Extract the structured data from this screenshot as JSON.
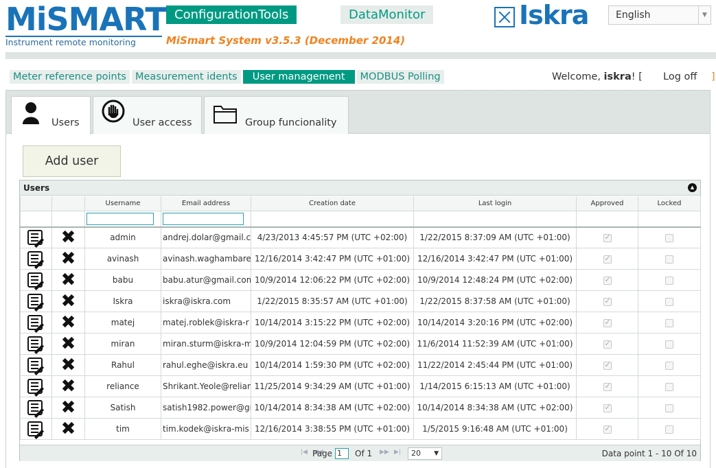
{
  "header": {
    "logo_text": "MiSMART",
    "logo_subtitle": "Instrument remote monitoring",
    "system_version": "MiSmart System v3.5.3 (December 2014)",
    "top_tabs": [
      "ConfigurationTools",
      "DataMonitor"
    ],
    "brand": "Iskra",
    "language": "English"
  },
  "nav": {
    "items": [
      "Meter reference points",
      "Measurement idents",
      "User management",
      "MODBUS Polling"
    ],
    "active": "User management",
    "welcome_prefix": "Welcome,",
    "username": "iskra",
    "welcome_suffix": "! [",
    "logoff": "Log off",
    "close_bracket": "]"
  },
  "tabs": [
    {
      "label": "Users",
      "icon": "user-icon",
      "active": true
    },
    {
      "label": "User access",
      "icon": "hand-icon",
      "active": false
    },
    {
      "label": "Group funcionality",
      "icon": "folder-icon",
      "active": false
    }
  ],
  "add_user_label": "Add user",
  "grid": {
    "caption": "Users",
    "columns": [
      "",
      "",
      "Username",
      "Email address",
      "Creation date",
      "Last login",
      "Approved",
      "Locked"
    ],
    "rows": [
      {
        "username": "admin",
        "email": "andrej.dolar@gmail.c",
        "created": "4/23/2013 4:45:57 PM (UTC +02:00)",
        "last_login": "1/22/2015 8:37:09 AM (UTC +01:00)",
        "approved": true,
        "locked": false
      },
      {
        "username": "avinash",
        "email": "avinash.waghambare",
        "created": "12/16/2014 3:42:47 PM (UTC +01:00)",
        "last_login": "12/16/2014 3:42:47 PM (UTC +01:00)",
        "approved": true,
        "locked": false
      },
      {
        "username": "babu",
        "email": "babu.atur@gmail.com",
        "created": "10/9/2014 12:06:22 PM (UTC +02:00)",
        "last_login": "10/9/2014 12:48:24 PM (UTC +02:00)",
        "approved": true,
        "locked": false
      },
      {
        "username": "Iskra",
        "email": "iskra@iskra.com",
        "created": "1/22/2015 8:35:57 AM (UTC +01:00)",
        "last_login": "1/22/2015 8:37:58 AM (UTC +01:00)",
        "approved": true,
        "locked": false
      },
      {
        "username": "matej",
        "email": "matej.roblek@iskra-r",
        "created": "10/14/2014 3:15:22 PM (UTC +02:00)",
        "last_login": "10/14/2014 3:20:16 PM (UTC +02:00)",
        "approved": true,
        "locked": false
      },
      {
        "username": "miran",
        "email": "miran.sturm@iskra-m",
        "created": "10/9/2014 12:04:59 PM (UTC +02:00)",
        "last_login": "11/6/2014 11:52:39 AM (UTC +01:00)",
        "approved": true,
        "locked": false
      },
      {
        "username": "Rahul",
        "email": "rahul.eghe@iskra.eu",
        "created": "10/14/2014 1:59:30 PM (UTC +02:00)",
        "last_login": "11/22/2014 2:45:44 PM (UTC +01:00)",
        "approved": true,
        "locked": false
      },
      {
        "username": "reliance",
        "email": "Shrikant.Yeole@relian",
        "created": "11/25/2014 9:34:29 AM (UTC +01:00)",
        "last_login": "1/14/2015 6:15:13 AM (UTC +01:00)",
        "approved": true,
        "locked": false
      },
      {
        "username": "Satish",
        "email": "satish1982.power@gr",
        "created": "10/14/2014 8:34:38 AM (UTC +02:00)",
        "last_login": "10/14/2014 8:34:38 AM (UTC +02:00)",
        "approved": true,
        "locked": false
      },
      {
        "username": "tim",
        "email": "tim.kodek@iskra-mis",
        "created": "12/16/2014 3:38:55 PM (UTC +01:00)",
        "last_login": "1/5/2015 9:16:48 AM (UTC +01:00)",
        "approved": true,
        "locked": false
      }
    ]
  },
  "pager": {
    "page_label": "Page",
    "page_value": "1",
    "of_label": "Of 1",
    "rows_per_page": "20",
    "info": "Data point 1 - 10 Of 10"
  }
}
